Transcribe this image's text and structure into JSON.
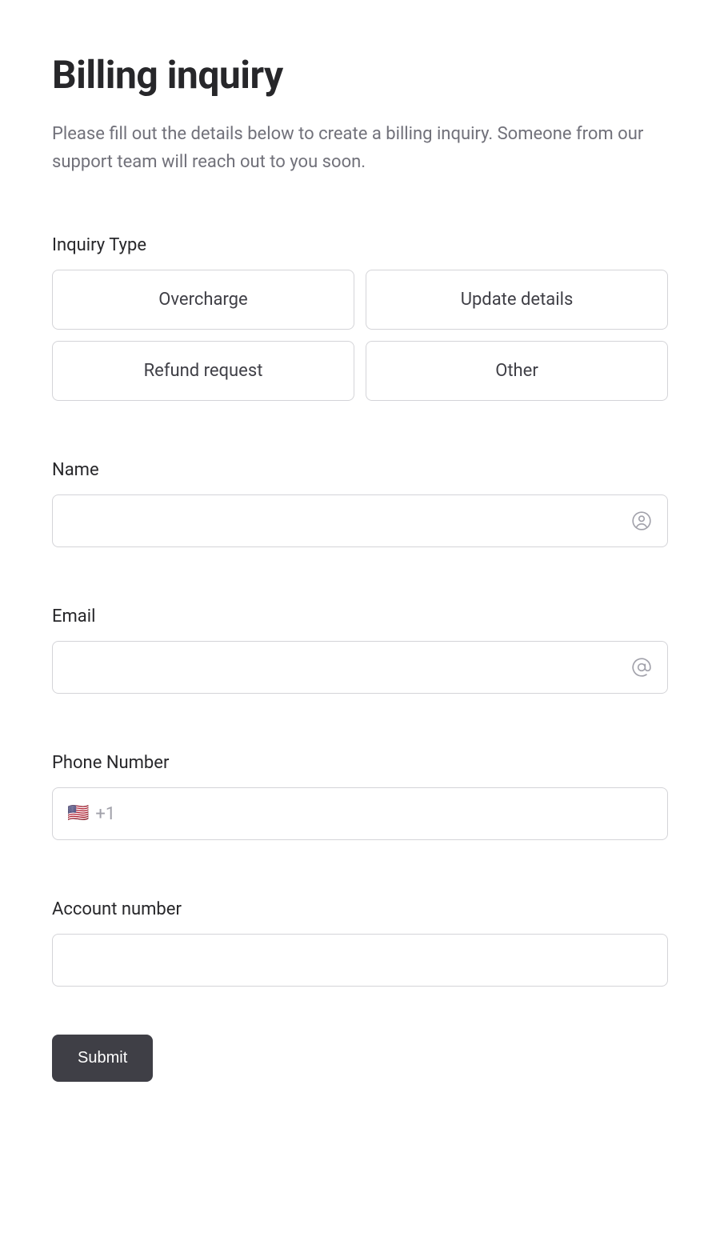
{
  "header": {
    "title": "Billing inquiry",
    "description": "Please fill out the details below to create a billing inquiry. Someone from our support team will reach out to you soon."
  },
  "form": {
    "inquiry_type": {
      "label": "Inquiry Type",
      "options": [
        "Overcharge",
        "Update details",
        "Refund request",
        "Other"
      ]
    },
    "name": {
      "label": "Name",
      "value": ""
    },
    "email": {
      "label": "Email",
      "value": ""
    },
    "phone": {
      "label": "Phone Number",
      "flag": "🇺🇸",
      "prefix": "+1",
      "value": ""
    },
    "account_number": {
      "label": "Account number",
      "value": ""
    },
    "submit_label": "Submit"
  }
}
